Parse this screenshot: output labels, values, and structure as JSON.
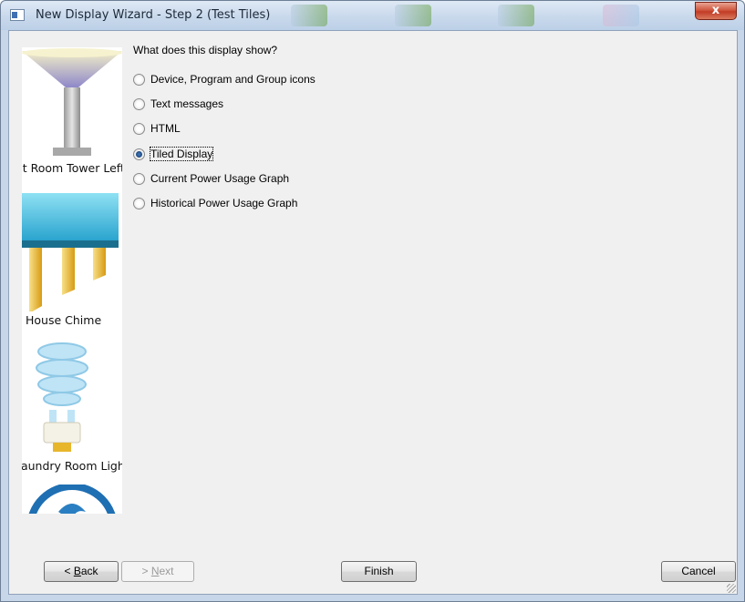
{
  "window": {
    "title": "New Display Wizard - Step 2 (Test Tiles)",
    "close_label": "x"
  },
  "preview": {
    "tiles": [
      {
        "label": "Pit Room Tower Left",
        "icon": "tower-lamp-icon"
      },
      {
        "label": "House Chime",
        "icon": "chime-icon"
      },
      {
        "label": "Laundry Room Lights",
        "icon": "cfl-bulb-icon"
      },
      {
        "label": "",
        "icon": "fan-icon"
      }
    ]
  },
  "question": "What does this display show?",
  "options": [
    {
      "label": "Device, Program and Group icons",
      "checked": false
    },
    {
      "label": "Text messages",
      "checked": false
    },
    {
      "label": "HTML",
      "checked": false
    },
    {
      "label": "Tiled Display",
      "checked": true
    },
    {
      "label": "Current Power Usage Graph",
      "checked": false
    },
    {
      "label": "Historical Power Usage Graph",
      "checked": false
    }
  ],
  "buttons": {
    "back_prefix": "< ",
    "back_mnemonic": "B",
    "back_rest": "ack",
    "next_prefix": "> ",
    "next_mnemonic": "N",
    "next_rest": "ext",
    "finish": "Finish",
    "cancel": "Cancel"
  },
  "colors": {
    "accent": "#3a6fb0",
    "close": "#c23b25",
    "background": "#f0f0f0"
  }
}
